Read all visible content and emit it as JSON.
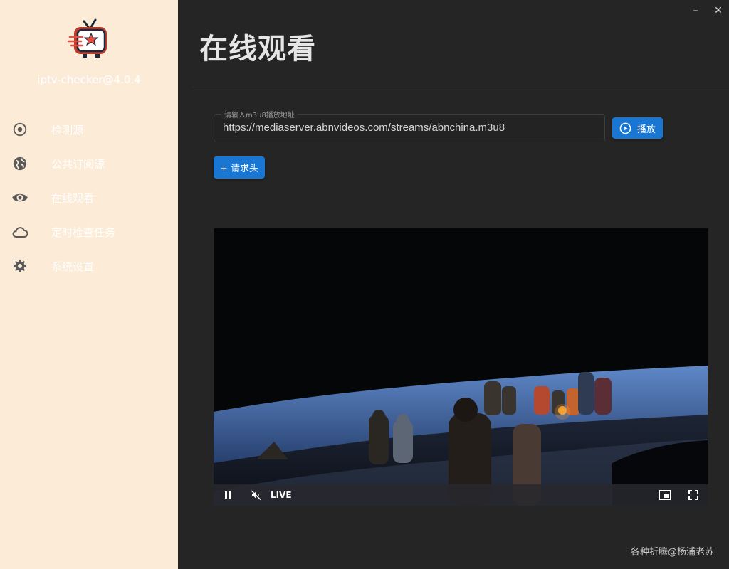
{
  "app": {
    "version_label": "iptv-checker@4.0.4",
    "logo_icon": "retro-tv-star-logo"
  },
  "sidebar": {
    "items": [
      {
        "label": "检测源",
        "icon": "target-icon"
      },
      {
        "label": "公共订阅源",
        "icon": "globe-icon"
      },
      {
        "label": "在线观看",
        "icon": "eye-icon"
      },
      {
        "label": "定时检查任务",
        "icon": "cloud-icon"
      },
      {
        "label": "系统设置",
        "icon": "gear-icon"
      }
    ]
  },
  "window": {
    "minimize_label": "–",
    "close_label": "✕"
  },
  "main": {
    "title": "在线观看",
    "url_field": {
      "legend": "请输入m3u8播放地址",
      "value": "https://mediaserver.abnvideos.com/streams/abnchina.m3u8"
    },
    "play_button_label": "播放",
    "request_header_button_label": "+ 请求头"
  },
  "player": {
    "live_label": "LIVE",
    "icons": [
      "pause-icon",
      "mute-icon",
      "picture-in-picture-icon",
      "fullscreen-icon"
    ]
  },
  "watermark": "各种折腾@杨浦老苏",
  "colors": {
    "sidebar_bg": "#fcebd7",
    "main_bg": "#252525",
    "accent": "#1976d2"
  }
}
